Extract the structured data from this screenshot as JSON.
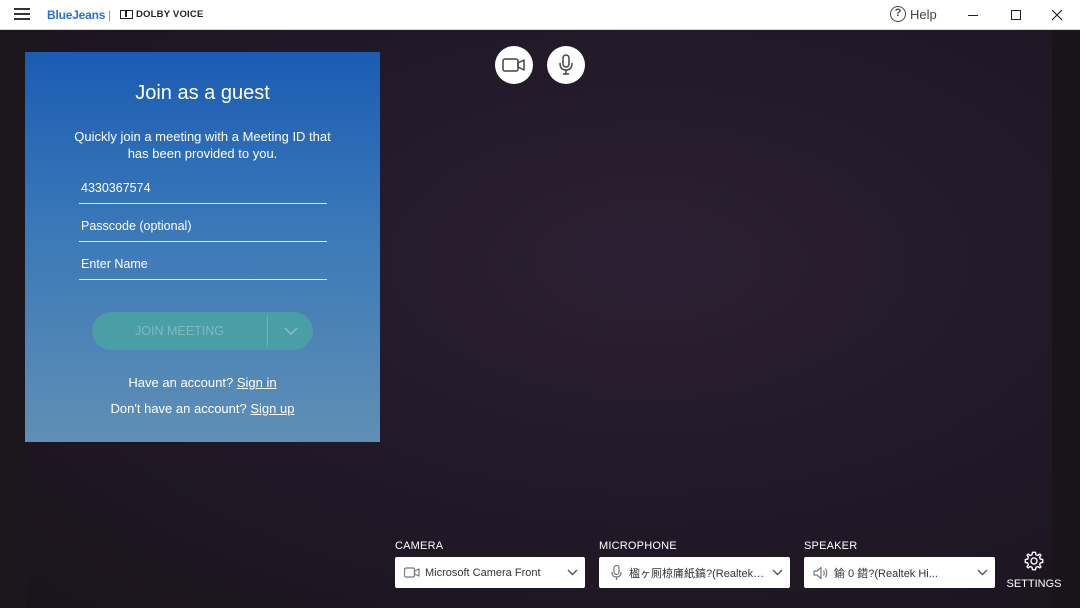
{
  "titlebar": {
    "brand": "BlueJeans",
    "separator": "|",
    "partner": "DOLBY VOICE",
    "help_label": "Help"
  },
  "guest": {
    "title": "Join as a guest",
    "description": "Quickly join a meeting with a Meeting ID that has been provided to you.",
    "meeting_id_value": "4330367574",
    "passcode_placeholder": "Passcode (optional)",
    "name_placeholder": "Enter Name",
    "join_label": "JOIN MEETING",
    "have_account_text": "Have an account?",
    "sign_in_label": "Sign in",
    "no_account_text": "Don't have an account?",
    "sign_up_label": "Sign up"
  },
  "devices": {
    "camera_label": "CAMERA",
    "camera_value": "Microsoft Camera Front",
    "microphone_label": "MICROPHONE",
    "microphone_value": "楹ヶ厠椋庯紙鎬?(Realtek Hi...",
    "speaker_label": "SPEAKER",
    "speaker_value": "鍮 0 鍣?(Realtek Hi..."
  },
  "settings_label": "SETTINGS",
  "colors": {
    "accent": "#2a6ed8",
    "panel_top": "#1b5cb3",
    "panel_bottom": "#5f8fb4",
    "join_button": "#4a9fa6",
    "background": "#211827"
  }
}
